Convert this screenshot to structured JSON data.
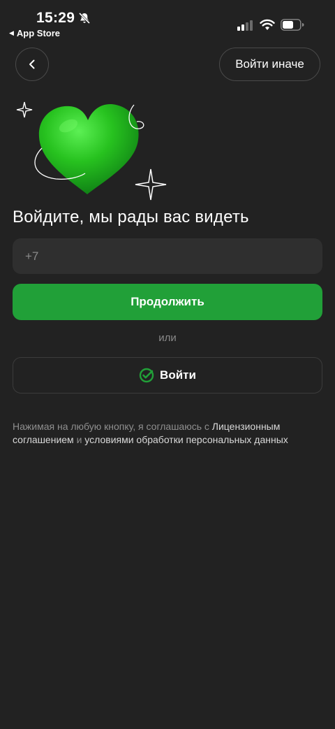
{
  "status_bar": {
    "time": "15:29",
    "back_app": "App Store"
  },
  "header": {
    "alt_login_label": "Войти иначе"
  },
  "main": {
    "title": "Войдите, мы рады вас видеть",
    "phone_placeholder": "+7",
    "continue_label": "Продолжить",
    "or_label": "или",
    "sber_login_label": "Войти"
  },
  "legal": {
    "part1": "Нажимая на любую кнопку, я соглашаюсь с ",
    "link1": "Лицензионным соглашением",
    "part2": " и ",
    "link2": "условиями обработки персональных данных"
  },
  "colors": {
    "background": "#222222",
    "accent_green": "#21a038",
    "field_bg": "#2f2f2f"
  },
  "icons": [
    "bell-off-icon",
    "cellular-signal-icon",
    "wifi-icon",
    "battery-icon",
    "chevron-left-icon",
    "green-heart-icon",
    "sparkle-icon",
    "sber-check-icon"
  ]
}
